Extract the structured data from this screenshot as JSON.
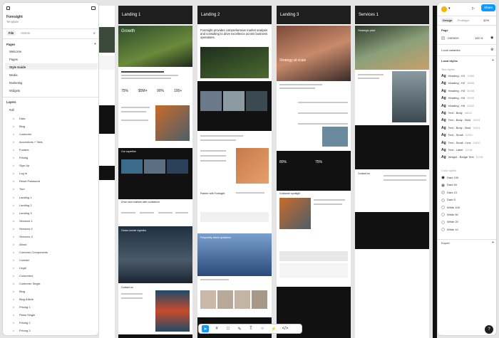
{
  "file": {
    "name": "Foresight",
    "subtitle": "Template"
  },
  "left_tabs": {
    "file": "File",
    "assets": "Assets"
  },
  "pages": {
    "heading": "Pages",
    "items": [
      "Welcome",
      "Pages",
      "Style Guide",
      "Media",
      "Marketing",
      "Widgets"
    ],
    "active_index": 2
  },
  "layers": {
    "heading": "Layers",
    "root": "all",
    "items": [
      "Data",
      "Blog",
      "Customer",
      "Accordions + Tabs",
      "Footers",
      "Pricing",
      "Sign Up",
      "Log In",
      "Reset Password",
      "Tour",
      "Landing 1",
      "Landing 2",
      "Landing 3",
      "Services 1",
      "Services 2",
      "Services 3",
      "About",
      "Common Components",
      "Contact",
      "Legal",
      "Customers",
      "Customer Single",
      "Blog",
      "Blog Article",
      "Pricing 1",
      "Plans Single",
      "Pricing 2",
      "Pricing 3"
    ]
  },
  "boards": [
    {
      "label": "Landing 1",
      "hero": "Growth"
    },
    {
      "label": "Landing 2",
      "hero": "Foresight provides comprehensive market analysis and consulting to drive excellence across business operations."
    },
    {
      "label": "Landing 3",
      "hero": "Strategy at scale"
    },
    {
      "label": "Services 1",
      "hero": "Strategic pilot"
    }
  ],
  "board_texts": {
    "stat1": "75%",
    "stat2": "$5M+",
    "stat3": "90%",
    "stat4": "100+",
    "our_expertise": "Our expertise",
    "drive": "Drive new markets with confidence",
    "ocean": "Ocean-border logistics",
    "contact": "Contact us",
    "faq": "Frequently asked questions",
    "partner": "Partner with Foresight",
    "customer": "Customer spotlight",
    "stat5": "80%",
    "stat6": "75%",
    "services_contact": "Contact us"
  },
  "right_panel": {
    "tabs": {
      "design": "Design",
      "prototype": "Prototype"
    },
    "zoom": "32%",
    "page_heading": "Page",
    "page_color": "D9D9D9",
    "page_opacity": "100",
    "page_opacity_unit": "%",
    "local_variables": "Local variables",
    "local_styles": "Local styles",
    "text_styles_heading": "Text styles",
    "text_styles": [
      {
        "name": "Heading - H1",
        "meta": "72/80"
      },
      {
        "name": "Heading - H2",
        "meta": "48/56"
      },
      {
        "name": "Heading - H3",
        "meta": "40/48"
      },
      {
        "name": "Heading - H4",
        "meta": "32/40"
      },
      {
        "name": "Heading - H5",
        "meta": "24/32"
      },
      {
        "name": "Text - Body",
        "meta": "16/24"
      },
      {
        "name": "Text - Body - Bold",
        "meta": "16/24"
      },
      {
        "name": "Text - Body - Bold",
        "meta": "16/24"
      },
      {
        "name": "Text - Small",
        "meta": "12/20"
      },
      {
        "name": "Text - Small - Link",
        "meta": "14/20"
      },
      {
        "name": "Text - Label",
        "meta": "12/16"
      },
      {
        "name": "Widget - Badge Text",
        "meta": "11/16"
      }
    ],
    "color_styles_heading": "Color styles",
    "color_styles": [
      {
        "name": "Dark 100",
        "color": "#1e1e1e"
      },
      {
        "name": "Dark 50",
        "color": "#7a7a7a"
      },
      {
        "name": "Dark 10",
        "color": "#e6e6e6"
      },
      {
        "name": "Dark 5",
        "color": "#f2f2f2"
      },
      {
        "name": "White 100",
        "color": "#ffffff"
      },
      {
        "name": "White 50",
        "color": "#ffffff"
      },
      {
        "name": "White 20",
        "color": "#ffffff"
      },
      {
        "name": "White 10",
        "color": "#ffffff"
      }
    ],
    "export": "Export"
  },
  "share_label": "Share",
  "help_label": "?",
  "toolbar_icons": [
    "move-icon",
    "frame-icon",
    "shape-icon",
    "pen-icon",
    "text-icon",
    "comment-icon",
    "actions-icon",
    "dev-mode-icon"
  ],
  "colors": {
    "accent": "#0d99ff",
    "dark": "#1e1e1e",
    "canvas": "#e5e5e5"
  }
}
